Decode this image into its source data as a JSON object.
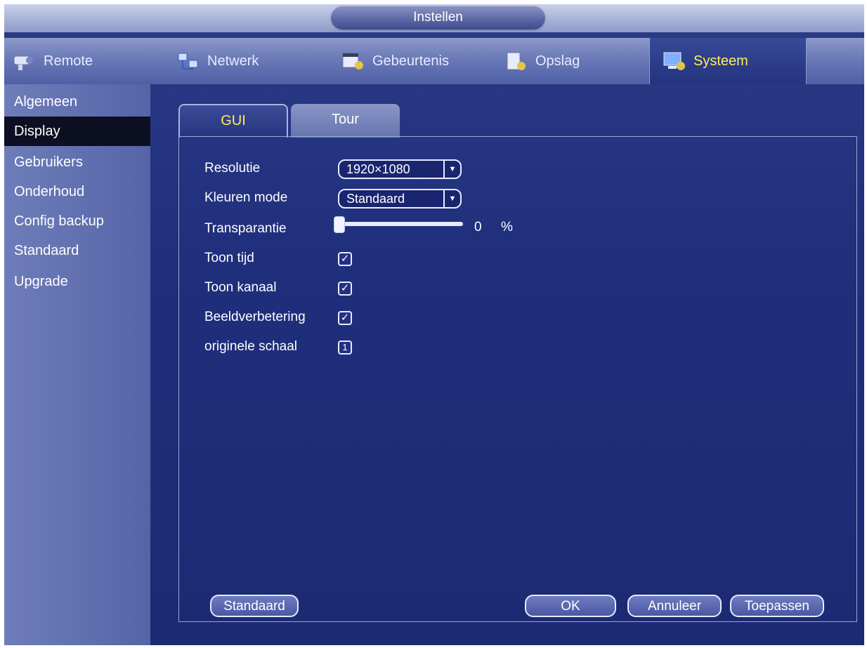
{
  "window": {
    "title": "Instellen"
  },
  "topnav": {
    "items": [
      {
        "label": "Remote",
        "icon": "camera-icon"
      },
      {
        "label": "Netwerk",
        "icon": "network-icon"
      },
      {
        "label": "Gebeurtenis",
        "icon": "event-icon"
      },
      {
        "label": "Opslag",
        "icon": "storage-icon"
      },
      {
        "label": "Systeem",
        "icon": "system-icon",
        "active": true
      }
    ]
  },
  "sidebar": {
    "items": [
      {
        "label": "Algemeen"
      },
      {
        "label": "Display",
        "active": true
      },
      {
        "label": "Gebruikers"
      },
      {
        "label": "Onderhoud"
      },
      {
        "label": "Config backup"
      },
      {
        "label": "Standaard"
      },
      {
        "label": "Upgrade"
      }
    ]
  },
  "tabs": [
    {
      "label": "GUI",
      "active": true
    },
    {
      "label": "Tour"
    }
  ],
  "form": {
    "resolution": {
      "label": "Resolutie",
      "value": "1920×1080"
    },
    "color_mode": {
      "label": "Kleuren mode",
      "value": "Standaard"
    },
    "transparency": {
      "label": "Transparantie",
      "value": "0",
      "unit": "%"
    },
    "show_time": {
      "label": "Toon tijd",
      "checked": true
    },
    "show_channel": {
      "label": "Toon kanaal",
      "checked": true
    },
    "image_enhance": {
      "label": "Beeldverbetering",
      "checked": true
    },
    "original_scale": {
      "label": "originele schaal",
      "value": "1"
    }
  },
  "buttons": {
    "default": "Standaard",
    "ok": "OK",
    "cancel": "Annuleer",
    "apply": "Toepassen"
  },
  "colors": {
    "active_text": "#ffee55",
    "background": "#1f2f7c"
  }
}
